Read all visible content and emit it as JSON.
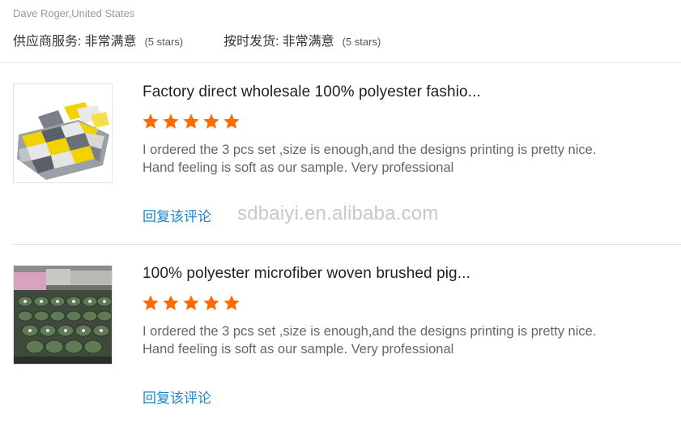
{
  "reviewer": {
    "name_location": "Dave Roger,United States"
  },
  "ratings": [
    {
      "label": "供应商服务:",
      "value": "非常满意",
      "stars_text": "(5 stars)"
    },
    {
      "label": "按时发货:",
      "value": "非常满意",
      "stars_text": "(5 stars)"
    }
  ],
  "reviews": [
    {
      "product_title": "Factory direct wholesale 100% polyester fashio...",
      "rating": 5,
      "text_line1": "I ordered the 3 pcs set ,size is enough,and the designs printing is pretty nice.",
      "text_line2": "Hand feeling is soft as our sample. Very professional",
      "reply_label": "回复该评论",
      "watermark": "sdbaiyi.en.alibaba.com"
    },
    {
      "product_title": "100% polyester microfiber woven brushed pig...",
      "rating": 5,
      "text_line1": "I ordered the 3 pcs set ,size is enough,and the designs printing is pretty nice.",
      "text_line2": "Hand feeling is soft as our sample. Very professional",
      "reply_label": "回复该评论"
    }
  ],
  "colors": {
    "star": "#ff6a00",
    "link": "#1a86c8",
    "muted": "#999999"
  }
}
